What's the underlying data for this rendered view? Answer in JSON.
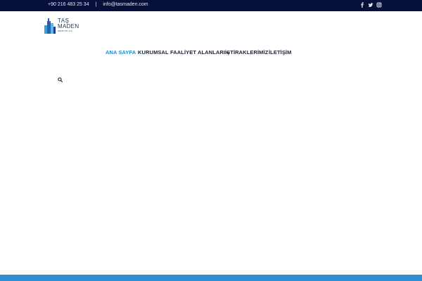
{
  "topbar": {
    "phone": "+90 216 483 25 34",
    "separator": "|",
    "email": "info@tasmaden.com",
    "social": [
      "facebook-icon",
      "twitter-icon",
      "instagram-icon"
    ]
  },
  "logo": {
    "line1": "TAŞ",
    "line2": "MADEN",
    "line3": "GRUP ŞTİ. A.Ş."
  },
  "nav": {
    "items": [
      {
        "label": "ANA SAYFA",
        "active": true
      },
      {
        "label": "KURUMSAL"
      },
      {
        "label": "FAALİYET ALANLARI",
        "has_dropdown": true
      },
      {
        "label": "İŞTİRAKLERİMİZ"
      },
      {
        "label": "İLETİŞİM"
      }
    ]
  },
  "colors": {
    "topbar_bg": "#07103a",
    "accent": "#1a8fd6",
    "footer_bar": "#2f8ed3",
    "nav_text": "#1f2233"
  }
}
